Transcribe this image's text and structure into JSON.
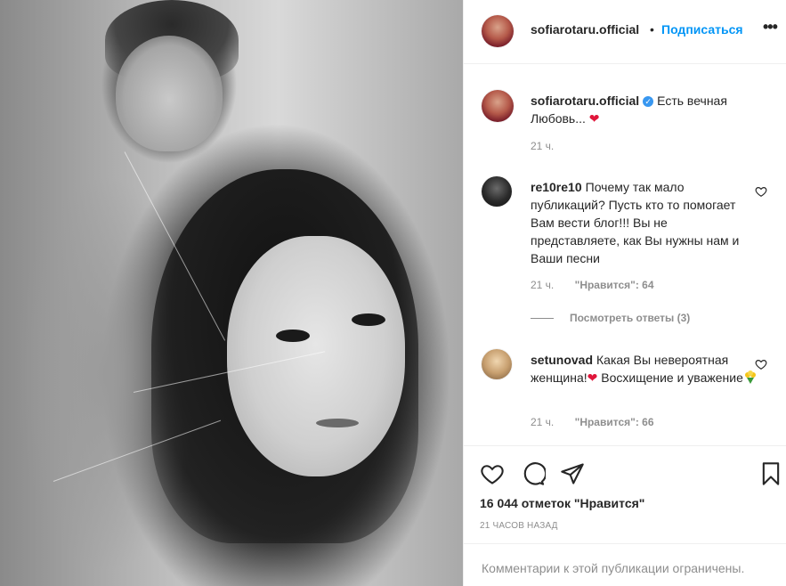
{
  "post": {
    "author": "sofiarotaru.official",
    "follow_label": "Подписаться",
    "dot": "•",
    "more": "•••",
    "caption_text": "Есть вечная Любовь...",
    "caption_emoji": "❤",
    "caption_time": "21 ч."
  },
  "comments": [
    {
      "user": "re10re10",
      "text": "Почему так мало публикаций? Пусть кто то помогает Вам вести блог!!! Вы не представляете, как Вы нужны нам и Ваши песни",
      "time": "21 ч.",
      "likes": "\"Нравится\": 64",
      "view_replies": "Посмотреть ответы (3)"
    },
    {
      "user": "setunovad",
      "text_1": "Какая Вы невероятная женщина!",
      "emoji_1": "❤",
      "text_2": "Восхищение и уважение",
      "time": "21 ч.",
      "likes": "\"Нравится\": 66"
    }
  ],
  "footer": {
    "likes_total": "16 044 отметок \"Нравится\"",
    "time_ago": "21 ЧАСОВ НАЗАД",
    "comments_limited": "Комментарии к этой публикации ограничены."
  },
  "icons": {
    "like": "heart-outline-icon",
    "comment": "speech-bubble-icon",
    "share": "paper-plane-icon",
    "save": "bookmark-icon"
  },
  "colors": {
    "accent": "#0095f6",
    "heart": "#e0163b",
    "muted": "#8e8e8e",
    "text": "#262626"
  }
}
